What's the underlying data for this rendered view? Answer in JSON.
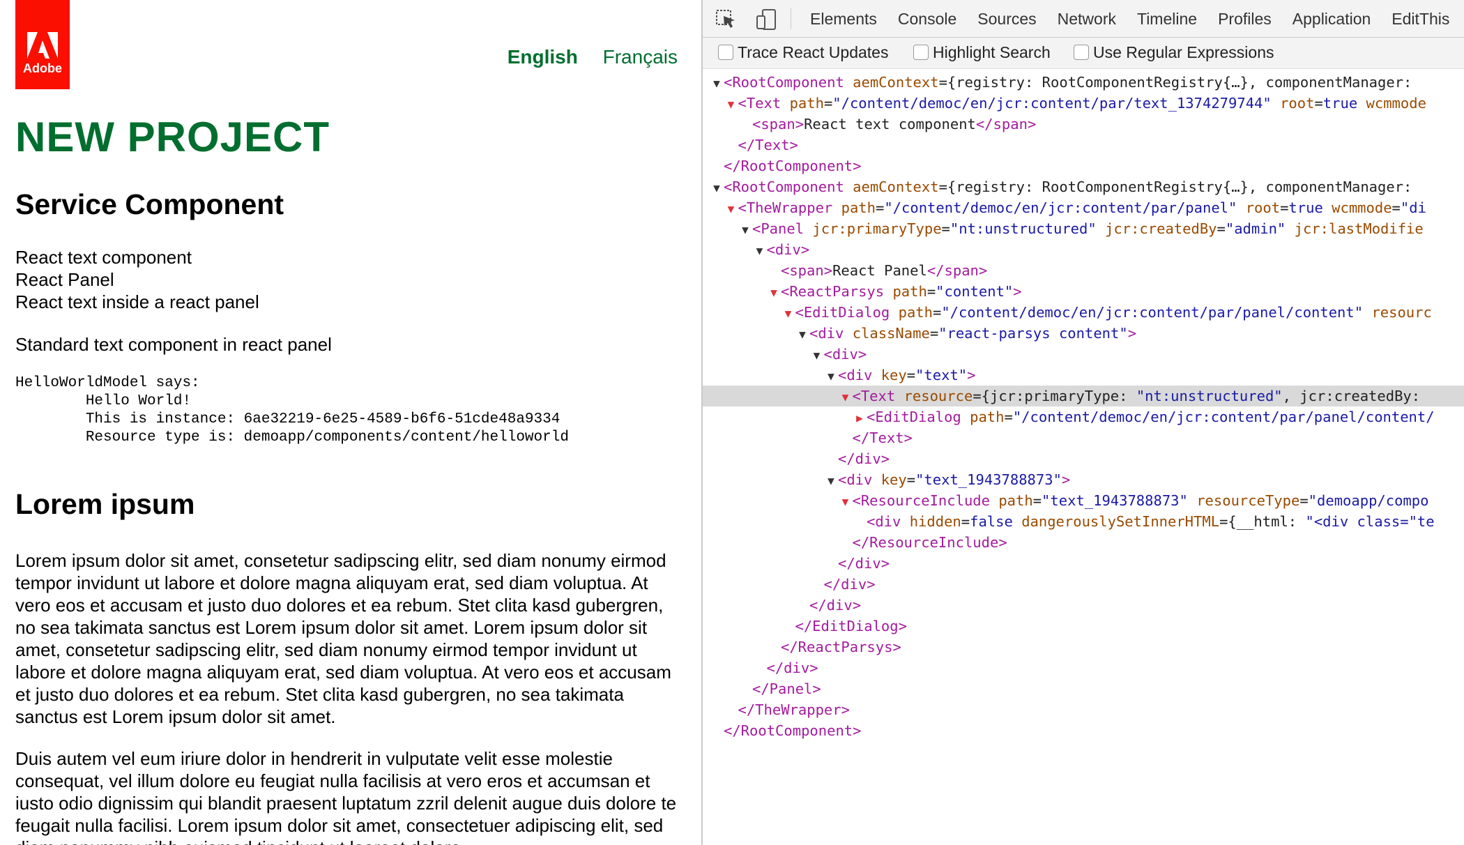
{
  "page": {
    "logo_text": "Adobe",
    "lang_active": "English",
    "lang_other": "Français",
    "title": "NEW PROJECT",
    "service_heading": "Service Component",
    "lines": [
      "React text component",
      "React Panel",
      "React text inside a react panel"
    ],
    "standard_text": "Standard text component in react panel",
    "helloworld": "HelloWorldModel says:\n        Hello World!\n        This is instance: 6ae32219-6e25-4589-b6f6-51cde48a9334\n        Resource type is: demoapp/components/content/helloworld",
    "lorem_heading": "Lorem ipsum",
    "para1": "Lorem ipsum dolor sit amet, consetetur sadipscing elitr, sed diam nonumy eirmod tempor invidunt ut labore et dolore magna aliquyam erat, sed diam voluptua. At vero eos et accusam et justo duo dolores et ea rebum. Stet clita kasd gubergren, no sea takimata sanctus est Lorem ipsum dolor sit amet. Lorem ipsum dolor sit amet, consetetur sadipscing elitr, sed diam nonumy eirmod tempor invidunt ut labore et dolore magna aliquyam erat, sed diam voluptua. At vero eos et accusam et justo duo dolores et ea rebum. Stet clita kasd gubergren, no sea takimata sanctus est Lorem ipsum dolor sit amet.",
    "para2": "Duis autem vel eum iriure dolor in hendrerit in vulputate velit esse molestie consequat, vel illum dolore eu feugiat nulla facilisis at vero eros et accumsan et iusto odio dignissim qui blandit praesent luptatum zzril delenit augue duis dolore te feugait nulla facilisi. Lorem ipsum dolor sit amet, consectetuer adipiscing elit, sed diam nonummy nibh euismod tincidunt ut laoreet dolore"
  },
  "devtools": {
    "tabs": [
      "Elements",
      "Console",
      "Sources",
      "Network",
      "Timeline",
      "Profiles",
      "Application",
      "EditThis"
    ],
    "options": [
      "Trace React Updates",
      "Highlight Search",
      "Use Regular Expressions"
    ],
    "tree": [
      {
        "indent": 0,
        "tri": "open",
        "tri_color": "dark",
        "parts": [
          [
            "t",
            "<RootComponent "
          ],
          [
            "a",
            "aemContext"
          ],
          [
            "x",
            "={registry: RootComponentRegistry{…}, componentManager:"
          ]
        ]
      },
      {
        "indent": 1,
        "tri": "open",
        "tri_color": "red",
        "parts": [
          [
            "t",
            "<Text "
          ],
          [
            "a",
            "path"
          ],
          [
            "x",
            "="
          ],
          [
            "v",
            "\"/content/democ/en/jcr:content/par/text_1374279744\""
          ],
          [
            "x",
            " "
          ],
          [
            "a",
            "root"
          ],
          [
            "x",
            "="
          ],
          [
            "v",
            "true"
          ],
          [
            "x",
            " "
          ],
          [
            "a",
            "wcmmode"
          ]
        ]
      },
      {
        "indent": 2,
        "tri": "none",
        "parts": [
          [
            "t",
            "<span>"
          ],
          [
            "x",
            "React text component"
          ],
          [
            "t",
            "</span>"
          ]
        ]
      },
      {
        "indent": 1,
        "tri": "none",
        "parts": [
          [
            "t",
            "</Text>"
          ]
        ]
      },
      {
        "indent": 0,
        "tri": "none",
        "parts": [
          [
            "t",
            "</RootComponent>"
          ]
        ]
      },
      {
        "indent": 0,
        "tri": "open",
        "tri_color": "dark",
        "parts": [
          [
            "t",
            "<RootComponent "
          ],
          [
            "a",
            "aemContext"
          ],
          [
            "x",
            "={registry: RootComponentRegistry{…}, componentManager:"
          ]
        ]
      },
      {
        "indent": 1,
        "tri": "open",
        "tri_color": "red",
        "parts": [
          [
            "t",
            "<TheWrapper "
          ],
          [
            "a",
            "path"
          ],
          [
            "x",
            "="
          ],
          [
            "v",
            "\"/content/democ/en/jcr:content/par/panel\""
          ],
          [
            "x",
            " "
          ],
          [
            "a",
            "root"
          ],
          [
            "x",
            "="
          ],
          [
            "v",
            "true"
          ],
          [
            "x",
            " "
          ],
          [
            "a",
            "wcmmode"
          ],
          [
            "x",
            "="
          ],
          [
            "v",
            "\"di"
          ]
        ]
      },
      {
        "indent": 2,
        "tri": "open",
        "tri_color": "dark",
        "parts": [
          [
            "t",
            "<Panel "
          ],
          [
            "a",
            "jcr:primaryType"
          ],
          [
            "x",
            "="
          ],
          [
            "v",
            "\"nt:unstructured\""
          ],
          [
            "x",
            " "
          ],
          [
            "a",
            "jcr:createdBy"
          ],
          [
            "x",
            "="
          ],
          [
            "v",
            "\"admin\""
          ],
          [
            "x",
            " "
          ],
          [
            "a",
            "jcr:lastModifie"
          ]
        ]
      },
      {
        "indent": 3,
        "tri": "open",
        "tri_color": "dark",
        "parts": [
          [
            "t",
            "<div>"
          ]
        ]
      },
      {
        "indent": 4,
        "tri": "none",
        "parts": [
          [
            "t",
            "<span>"
          ],
          [
            "x",
            "React Panel"
          ],
          [
            "t",
            "</span>"
          ]
        ]
      },
      {
        "indent": 4,
        "tri": "open",
        "tri_color": "red",
        "parts": [
          [
            "t",
            "<ReactParsys "
          ],
          [
            "a",
            "path"
          ],
          [
            "x",
            "="
          ],
          [
            "v",
            "\"content\""
          ],
          [
            "t",
            ">"
          ]
        ]
      },
      {
        "indent": 5,
        "tri": "open",
        "tri_color": "red",
        "parts": [
          [
            "t",
            "<EditDialog "
          ],
          [
            "a",
            "path"
          ],
          [
            "x",
            "="
          ],
          [
            "v",
            "\"/content/democ/en/jcr:content/par/panel/content\""
          ],
          [
            "x",
            " "
          ],
          [
            "a",
            "resourc"
          ]
        ]
      },
      {
        "indent": 6,
        "tri": "open",
        "tri_color": "dark",
        "parts": [
          [
            "t",
            "<div "
          ],
          [
            "a",
            "className"
          ],
          [
            "x",
            "="
          ],
          [
            "v",
            "\"react-parsys content\""
          ],
          [
            "t",
            ">"
          ]
        ]
      },
      {
        "indent": 7,
        "tri": "open",
        "tri_color": "dark",
        "parts": [
          [
            "t",
            "<div>"
          ]
        ]
      },
      {
        "indent": 8,
        "tri": "open",
        "tri_color": "dark",
        "parts": [
          [
            "t",
            "<div "
          ],
          [
            "a",
            "key"
          ],
          [
            "x",
            "="
          ],
          [
            "v",
            "\"text\""
          ],
          [
            "t",
            ">"
          ]
        ]
      },
      {
        "indent": 9,
        "tri": "open",
        "tri_color": "red",
        "selected": true,
        "parts": [
          [
            "t",
            "<Text "
          ],
          [
            "a",
            "resource"
          ],
          [
            "x",
            "={jcr:primaryType: "
          ],
          [
            "v",
            "\"nt:unstructured\""
          ],
          [
            "x",
            ", jcr:createdBy:"
          ]
        ]
      },
      {
        "indent": 10,
        "tri": "closed",
        "tri_color": "red",
        "parts": [
          [
            "t",
            "<EditDialog "
          ],
          [
            "a",
            "path"
          ],
          [
            "x",
            "="
          ],
          [
            "v",
            "\"/content/democ/en/jcr:content/par/panel/content/"
          ]
        ]
      },
      {
        "indent": 9,
        "tri": "none",
        "parts": [
          [
            "t",
            "</Text>"
          ]
        ]
      },
      {
        "indent": 8,
        "tri": "none",
        "parts": [
          [
            "t",
            "</div>"
          ]
        ]
      },
      {
        "indent": 8,
        "tri": "open",
        "tri_color": "dark",
        "parts": [
          [
            "t",
            "<div "
          ],
          [
            "a",
            "key"
          ],
          [
            "x",
            "="
          ],
          [
            "v",
            "\"text_1943788873\""
          ],
          [
            "t",
            ">"
          ]
        ]
      },
      {
        "indent": 9,
        "tri": "open",
        "tri_color": "red",
        "parts": [
          [
            "t",
            "<ResourceInclude "
          ],
          [
            "a",
            "path"
          ],
          [
            "x",
            "="
          ],
          [
            "v",
            "\"text_1943788873\""
          ],
          [
            "x",
            " "
          ],
          [
            "a",
            "resourceType"
          ],
          [
            "x",
            "="
          ],
          [
            "v",
            "\"demoapp/compo"
          ]
        ]
      },
      {
        "indent": 10,
        "tri": "none",
        "parts": [
          [
            "t",
            "<div "
          ],
          [
            "a",
            "hidden"
          ],
          [
            "x",
            "="
          ],
          [
            "v",
            "false"
          ],
          [
            "x",
            " "
          ],
          [
            "a",
            "dangerouslySetInnerHTML"
          ],
          [
            "x",
            "={__html: "
          ],
          [
            "v",
            "\"<div class=\"te"
          ]
        ]
      },
      {
        "indent": 9,
        "tri": "none",
        "parts": [
          [
            "t",
            "</ResourceInclude>"
          ]
        ]
      },
      {
        "indent": 8,
        "tri": "none",
        "parts": [
          [
            "t",
            "</div>"
          ]
        ]
      },
      {
        "indent": 7,
        "tri": "none",
        "parts": [
          [
            "t",
            "</div>"
          ]
        ]
      },
      {
        "indent": 6,
        "tri": "none",
        "parts": [
          [
            "t",
            "</div>"
          ]
        ]
      },
      {
        "indent": 5,
        "tri": "none",
        "parts": [
          [
            "t",
            "</EditDialog>"
          ]
        ]
      },
      {
        "indent": 4,
        "tri": "none",
        "parts": [
          [
            "t",
            "</ReactParsys>"
          ]
        ]
      },
      {
        "indent": 3,
        "tri": "none",
        "parts": [
          [
            "t",
            "</div>"
          ]
        ]
      },
      {
        "indent": 2,
        "tri": "none",
        "parts": [
          [
            "t",
            "</Panel>"
          ]
        ]
      },
      {
        "indent": 1,
        "tri": "none",
        "parts": [
          [
            "t",
            "</TheWrapper>"
          ]
        ]
      },
      {
        "indent": 0,
        "tri": "none",
        "parts": [
          [
            "t",
            "</RootComponent>"
          ]
        ]
      }
    ]
  }
}
